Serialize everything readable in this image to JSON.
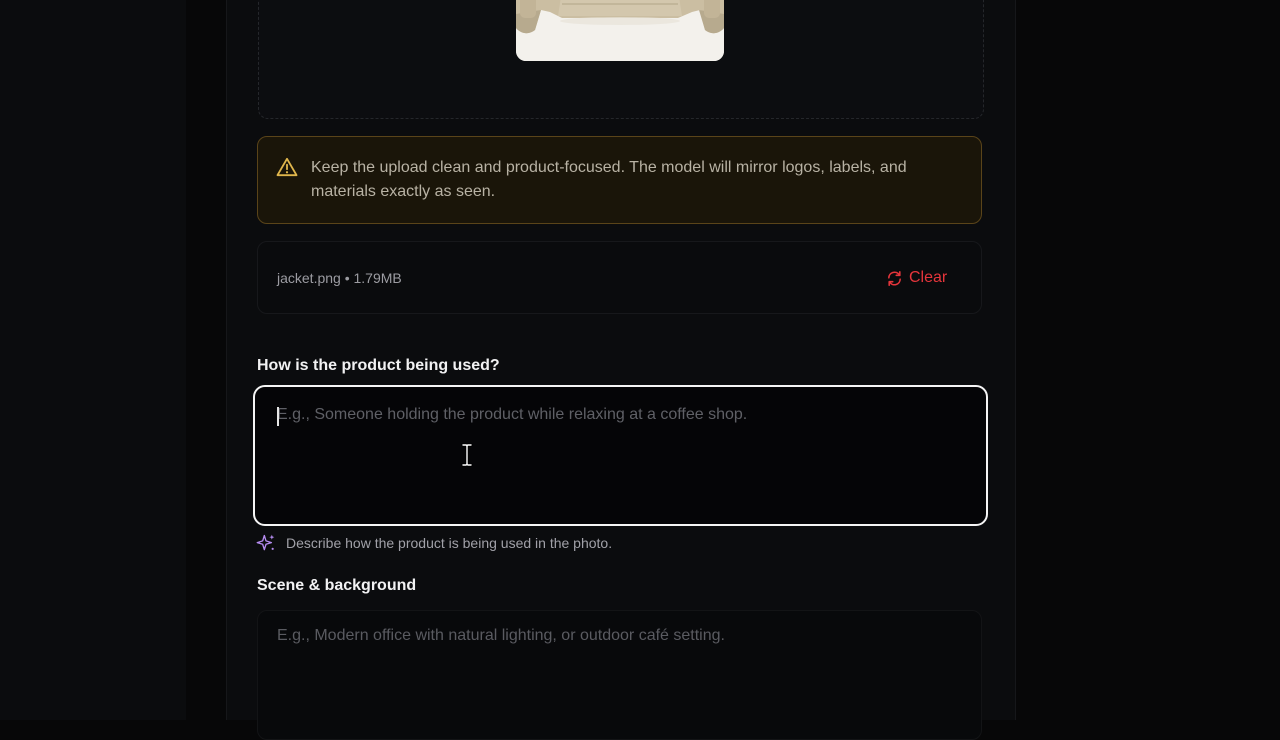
{
  "upload": {
    "preview_alt": "jacket preview thumbnail",
    "file_name": "jacket.png",
    "separator": "•",
    "file_size": "1.79MB",
    "file_meta": "jacket.png • 1.79MB",
    "clear_label": "Clear"
  },
  "warning": {
    "icon": "warning-triangle-icon",
    "text": "Keep the upload clean and product-focused. The model will mirror logos, labels, and materials exactly as seen."
  },
  "usage": {
    "label": "How is the product being used?",
    "value": "",
    "placeholder": "E.g., Someone holding the product while relaxing at a coffee shop.",
    "hint_icon": "sparkle-icon",
    "hint": "Describe how the product is being used in the photo."
  },
  "scene": {
    "label": "Scene & background",
    "value": "",
    "placeholder": "E.g., Modern office with natural lighting, or outdoor café setting."
  },
  "colors": {
    "background": "#0b0c0e",
    "warning_border": "#5a4419",
    "warning_icon": "#e0b64c",
    "clear": "#e5353b",
    "sparkle": "#b58cf0",
    "focus_border": "#f5f5f5"
  }
}
